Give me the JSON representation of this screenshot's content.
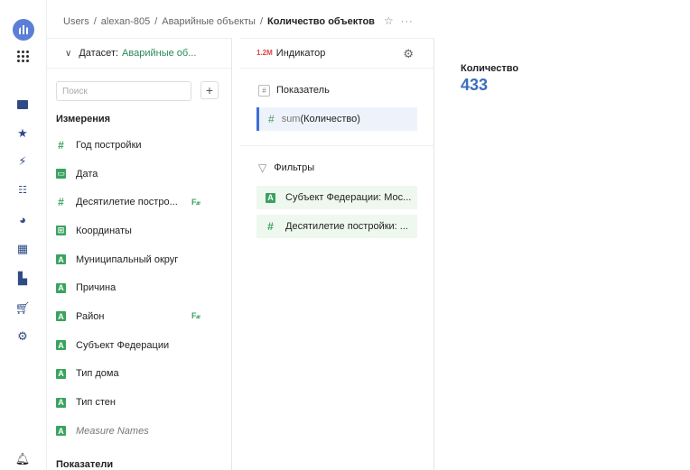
{
  "breadcrumb": {
    "items": [
      "Users",
      "alexan-805",
      "Аварийные объекты"
    ],
    "current": "Количество объектов",
    "separator": "/",
    "more": "···"
  },
  "dataset": {
    "label": "Датасет:",
    "name": "Аварийные об...",
    "search_placeholder": "Поиск",
    "add": "+",
    "dimensions_title": "Измерения",
    "dimensions": [
      {
        "label": "Год постройки",
        "type": "number-icon",
        "glyph": "#"
      },
      {
        "label": "Дата",
        "type": "date-icon",
        "glyph": "▭"
      },
      {
        "label": "Десятилетие постро...",
        "type": "number-icon",
        "glyph": "#",
        "fx": "F𝓍"
      },
      {
        "label": "Координаты",
        "type": "geo-icon",
        "glyph": "⊞"
      },
      {
        "label": "Муниципальный округ",
        "type": "string-icon",
        "glyph": "A"
      },
      {
        "label": "Причина",
        "type": "string-icon",
        "glyph": "A"
      },
      {
        "label": "Район",
        "type": "string-icon",
        "glyph": "A",
        "fx": "F𝓍"
      },
      {
        "label": "Субъект Федерации",
        "type": "string-icon",
        "glyph": "A"
      },
      {
        "label": "Тип дома",
        "type": "string-icon",
        "glyph": "A"
      },
      {
        "label": "Тип стен",
        "type": "string-icon",
        "glyph": "A"
      },
      {
        "label": "Measure Names",
        "type": "string-icon",
        "glyph": "A"
      }
    ],
    "measures_title": "Показатели"
  },
  "wizard": {
    "viz_icon": "1.2M",
    "viz_type": "Индикатор",
    "measure_section": "Показатель",
    "measure_fn": "sum",
    "measure_field": "(Количество)",
    "filters_section": "Фильтры",
    "filters": [
      "Субъект Федерации: Мос...",
      "Десятилетие постройки: ..."
    ]
  },
  "indicator": {
    "title": "Количество",
    "value": "433"
  },
  "colors": {
    "accent": "#3b6fd8",
    "field_green": "#3aa35f",
    "value_blue": "#3b6fbf",
    "logo": "#5b7fd6"
  }
}
